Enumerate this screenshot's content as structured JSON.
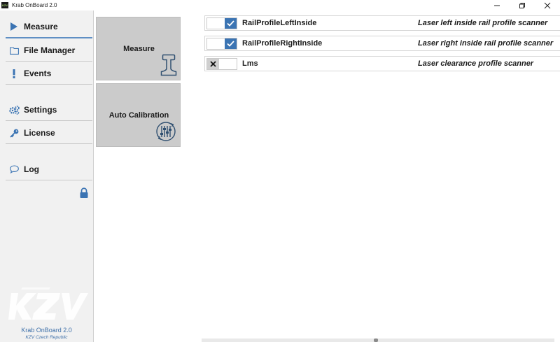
{
  "window": {
    "title": "Krab OnBoard 2.0",
    "logo_text": "KZV"
  },
  "sidebar": {
    "items": [
      {
        "label": "Measure",
        "icon": "play-icon",
        "active": true
      },
      {
        "label": "File Manager",
        "icon": "folder-icon",
        "active": false
      },
      {
        "label": "Events",
        "icon": "exclamation-icon",
        "active": false
      },
      {
        "label": "Settings",
        "icon": "gears-icon",
        "active": false
      },
      {
        "label": "License",
        "icon": "key-icon",
        "active": false
      },
      {
        "label": "Log",
        "icon": "chat-bubble-icon",
        "active": false
      }
    ],
    "footer_app_name": "Krab OnBoard 2.0",
    "footer_company": "KZV Czech Republic"
  },
  "tiles": [
    {
      "label": "Measure",
      "icon": "rail-profile-icon"
    },
    {
      "label": "Auto Calibration",
      "icon": "calibration-sliders-icon"
    }
  ],
  "sensors": [
    {
      "name": "RailProfileLeftInside",
      "description": "Laser left inside rail profile scanner",
      "enabled": true
    },
    {
      "name": "RailProfileRightInside",
      "description": "Laser right inside rail profile scanner",
      "enabled": true
    },
    {
      "name": "Lms",
      "description": "Laser clearance profile scanner",
      "enabled": false
    }
  ],
  "colors": {
    "accent": "#3b74b3",
    "sidebar_bg": "#f1f1f1",
    "tile_bg": "#cbcbcb",
    "footer_text": "#3d6fa9"
  }
}
